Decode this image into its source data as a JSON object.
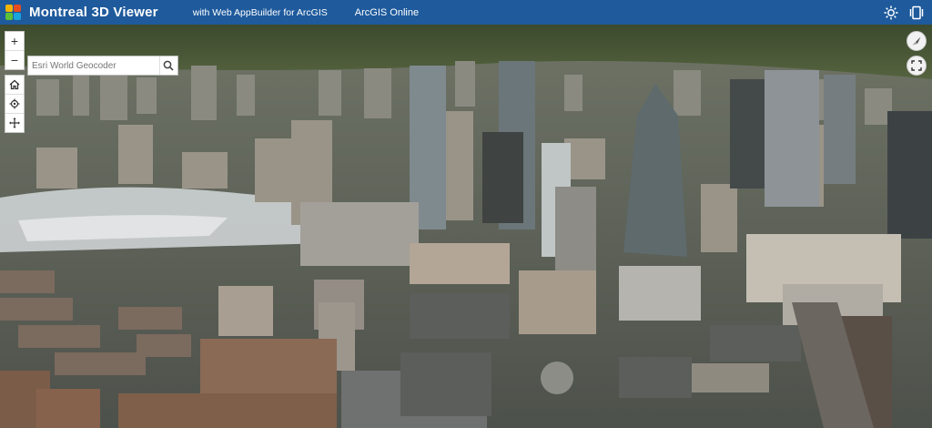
{
  "header": {
    "title": "Montreal 3D Viewer",
    "subtitle": "with Web AppBuilder for ArcGIS",
    "link": "ArcGIS Online",
    "logo_icon": "globe-logo-icon",
    "right_icons": [
      "brightness-icon",
      "device-icon"
    ]
  },
  "search": {
    "placeholder": "Esri World Geocoder",
    "icon": "search-icon"
  },
  "map_controls": {
    "zoom_in": "+",
    "zoom_out": "−",
    "icons": [
      "home-icon",
      "locate-icon",
      "pan-icon",
      "compass-icon",
      "fullscreen-icon"
    ]
  },
  "colors": {
    "header_bg": "#1e5a9c",
    "header_text": "#ffffff"
  }
}
